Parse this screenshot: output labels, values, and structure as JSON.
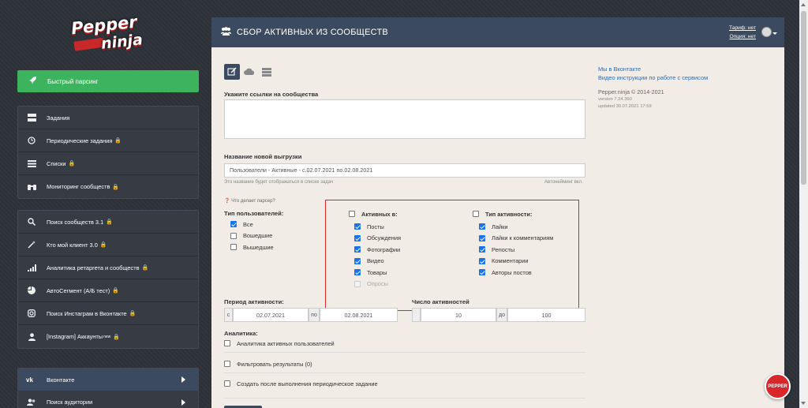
{
  "logo": {
    "line1": "Pepper",
    "line2": "ninja"
  },
  "sidebar": {
    "quick": {
      "label": "Быстрый парсинг",
      "icon": "rocket-icon"
    },
    "group1": [
      {
        "label": "Задания",
        "icon": "server-icon",
        "locked": false
      },
      {
        "label": "Периодические задания",
        "icon": "clock-icon",
        "locked": true
      },
      {
        "label": "Списки",
        "icon": "list-icon",
        "locked": true
      },
      {
        "label": "Мониторинг сообществ",
        "icon": "binoculars-icon",
        "locked": true
      }
    ],
    "group2": [
      {
        "label": "Поиск сообществ 3.1",
        "icon": "search-icon",
        "locked": true
      },
      {
        "label": "Кто мой клиент 3.0",
        "icon": "magic-wand-icon",
        "locked": true
      },
      {
        "label": "Аналитика ретаргета и сообществ",
        "icon": "signal-bars-icon",
        "locked": true
      },
      {
        "label": "АвтоСегмент (А/Б тест)",
        "icon": "pie-chart-icon",
        "locked": true
      },
      {
        "label": "Поиск Инстаграм в Вконтакте",
        "icon": "instagram-icon",
        "locked": true
      },
      {
        "label": "[Instagram] Аккаунты",
        "sup": "new",
        "icon": "user-icon",
        "locked": true
      }
    ],
    "vk": {
      "label": "Вконтакте",
      "icon": "vk-icon"
    },
    "audience": {
      "label": "Поиск аудитории",
      "icon": "users-icon"
    }
  },
  "header": {
    "title": "СБОР АКТИВНЫХ ИЗ СООБЩЕСТВ",
    "tariff": "Тариф: нет",
    "option": "Опция: нет"
  },
  "form": {
    "links_label": "Укажите ссылки на сообщества",
    "export_label": "Название новой выгрузки",
    "export_value": "Пользователи - Активные - с.02.07.2021 по.02.08.2021",
    "export_hint": "Это название будет отображаться в списке задач",
    "autoname": "Автонейминг вкл.",
    "help": "Что делает парсер?",
    "user_type_label": "Тип пользователей:",
    "user_types": [
      {
        "label": "Все",
        "checked": true
      },
      {
        "label": "Вошедшие",
        "checked": false
      },
      {
        "label": "Вышедшие",
        "checked": false
      }
    ],
    "active_in_label": "Активных в:",
    "active_in": [
      {
        "label": "Посты",
        "checked": true,
        "disabled": false
      },
      {
        "label": "Обсуждения",
        "checked": true,
        "disabled": false
      },
      {
        "label": "Фотографии",
        "checked": true,
        "disabled": false
      },
      {
        "label": "Видео",
        "checked": true,
        "disabled": false
      },
      {
        "label": "Товары",
        "checked": true,
        "disabled": false
      },
      {
        "label": "Опросы",
        "checked": false,
        "disabled": true
      }
    ],
    "activity_type_label": "Тип активности:",
    "activity_types": [
      {
        "label": "Лайки",
        "checked": true
      },
      {
        "label": "Лайки к комментариям",
        "checked": true
      },
      {
        "label": "Репосты",
        "checked": true
      },
      {
        "label": "Комментарии",
        "checked": true
      },
      {
        "label": "Авторы постов",
        "checked": true
      }
    ],
    "period_label": "Период активности:",
    "period_from_prefix": "с",
    "period_from": "02.07.2021",
    "period_to_prefix": "по",
    "period_to": "02.08.2021",
    "count_label": "Число активностей",
    "count_from": "10",
    "count_to_prefix": "до",
    "count_to": "100",
    "analytics_label": "Аналитика:",
    "analytics_option": "Аналитика активных пользователей",
    "filter_option": "Фильтровать результаты (0)",
    "periodic_option": "Создать после выполнения периодическое задание"
  },
  "right": {
    "link1": "Мы в Вконтакте",
    "link2": "Видео инструкции по работе с сервисом",
    "copyright": "Pepper.ninja © 2014-2021",
    "version": "version 7.24.360",
    "updated": "updated 30.07.2021 17:59"
  },
  "bubble": "PEPPER"
}
